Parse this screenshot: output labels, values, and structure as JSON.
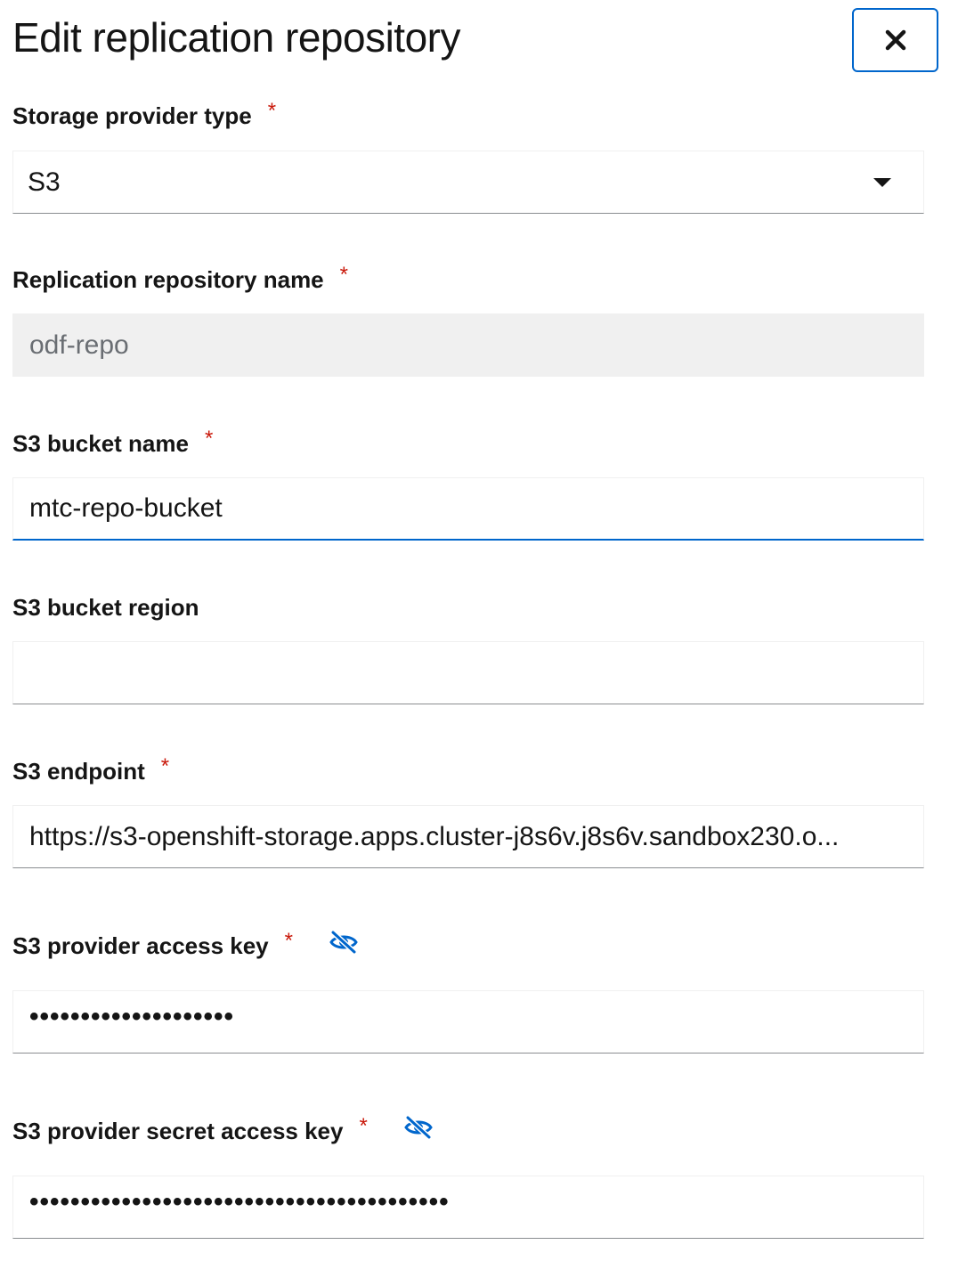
{
  "dialog": {
    "title": "Edit replication repository"
  },
  "fields": {
    "storage_provider_type": {
      "label": "Storage provider type",
      "required": "*",
      "value": "S3"
    },
    "repository_name": {
      "label": "Replication repository name",
      "required": "*",
      "value": "odf-repo"
    },
    "bucket_name": {
      "label": "S3 bucket name",
      "required": "*",
      "value": "mtc-repo-bucket"
    },
    "bucket_region": {
      "label": "S3 bucket region",
      "value": ""
    },
    "endpoint": {
      "label": "S3 endpoint",
      "required": "*",
      "value": "https://s3-openshift-storage.apps.cluster-j8s6v.j8s6v.sandbox230.o..."
    },
    "access_key": {
      "label": "S3 provider access key",
      "required": "*",
      "value": "••••••••••••••••••••"
    },
    "secret_key": {
      "label": "S3 provider secret access key",
      "required": "*",
      "value": "•••••••••••••••••••••••••••••••••••••••••"
    }
  },
  "icons": {
    "close": "close-icon",
    "select_caret": "caret-down-icon",
    "toggle_visibility": "eye-slash-icon"
  },
  "colors": {
    "accent": "#0066cc",
    "required": "#c9190b",
    "disabled_bg": "#f0f0f0"
  }
}
